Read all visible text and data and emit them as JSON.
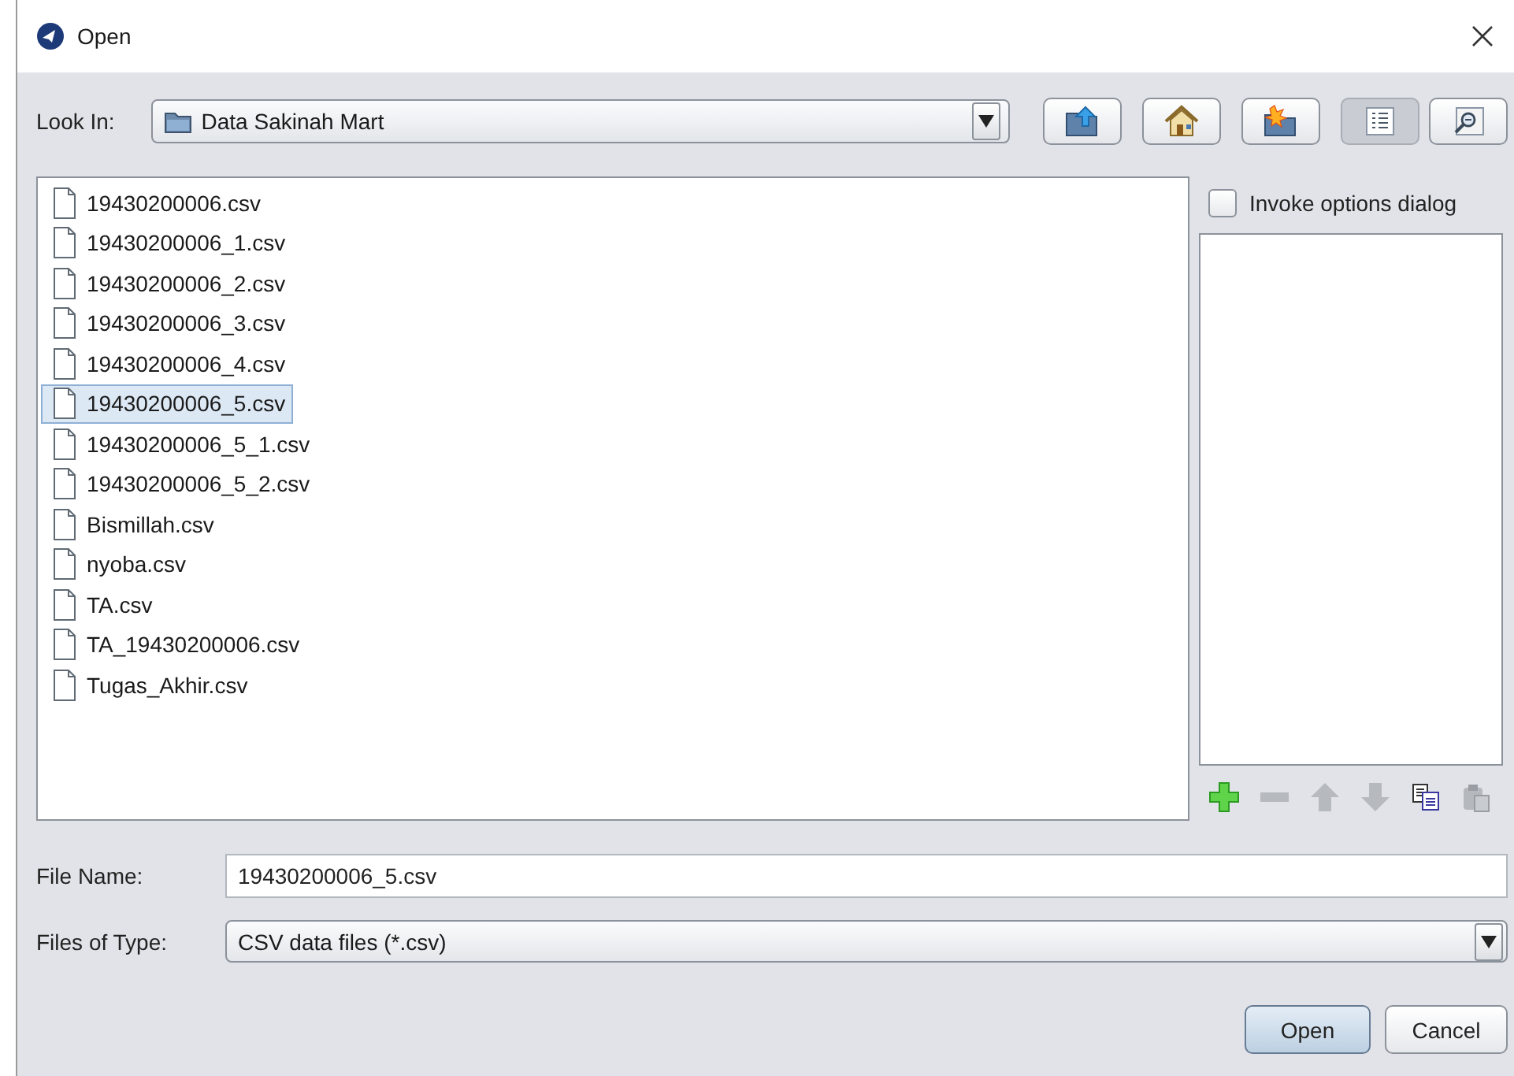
{
  "window": {
    "title": "Open"
  },
  "look_in": {
    "label": "Look In:",
    "value": "Data Sakinah Mart"
  },
  "toolbar": [
    {
      "kind": "up",
      "selected": false
    },
    {
      "kind": "home",
      "selected": false
    },
    {
      "kind": "newfolder",
      "selected": false
    },
    {
      "kind": "list",
      "selected": true
    },
    {
      "kind": "details",
      "selected": false
    }
  ],
  "files": [
    {
      "name": "19430200006.csv",
      "selected": false
    },
    {
      "name": "19430200006_1.csv",
      "selected": false
    },
    {
      "name": "19430200006_2.csv",
      "selected": false
    },
    {
      "name": "19430200006_3.csv",
      "selected": false
    },
    {
      "name": "19430200006_4.csv",
      "selected": false
    },
    {
      "name": "19430200006_5.csv",
      "selected": true
    },
    {
      "name": "19430200006_5_1.csv",
      "selected": false
    },
    {
      "name": "19430200006_5_2.csv",
      "selected": false
    },
    {
      "name": "Bismillah.csv",
      "selected": false
    },
    {
      "name": "nyoba.csv",
      "selected": false
    },
    {
      "name": "TA.csv",
      "selected": false
    },
    {
      "name": "TA_19430200006.csv",
      "selected": false
    },
    {
      "name": "Tugas_Akhir.csv",
      "selected": false
    }
  ],
  "options": {
    "label": "Invoke options dialog",
    "checked": false
  },
  "option_tools": [
    {
      "kind": "add",
      "disabled": false
    },
    {
      "kind": "remove",
      "disabled": true
    },
    {
      "kind": "up",
      "disabled": true
    },
    {
      "kind": "down",
      "disabled": true
    },
    {
      "kind": "copy",
      "disabled": false
    },
    {
      "kind": "paste",
      "disabled": true
    }
  ],
  "file_name": {
    "label": "File Name:",
    "value": "19430200006_5.csv"
  },
  "file_type": {
    "label": "Files of Type:",
    "value": "CSV data files (*.csv)"
  },
  "buttons": [
    {
      "label": "Open",
      "default": true
    },
    {
      "label": "Cancel",
      "default": false
    }
  ]
}
